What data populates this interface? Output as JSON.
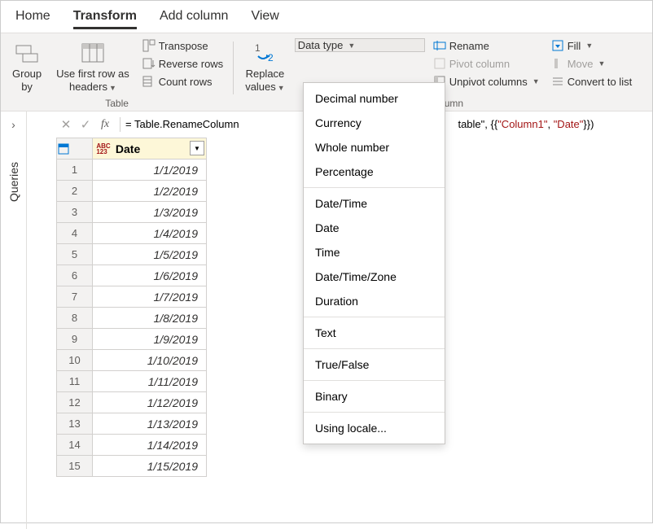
{
  "tabs": {
    "home": "Home",
    "transform": "Transform",
    "addcolumn": "Add column",
    "view": "View",
    "active": "Transform"
  },
  "ribbon": {
    "groupBy": "Group\nby",
    "useFirstRow": "Use first row as\nheaders",
    "transpose": "Transpose",
    "reverseRows": "Reverse rows",
    "countRows": "Count rows",
    "tableGroup": "Table",
    "replaceValues": "Replace\nvalues",
    "dataType": "Data type",
    "rename": "Rename",
    "fill": "Fill",
    "pivotColumn": "Pivot column",
    "move": "Move",
    "unpivotColumns": "Unpivot columns",
    "convertToList": "Convert to list",
    "anyColumnGroup": "Any column"
  },
  "formula": {
    "prefix": "= ",
    "fn": "Table.RenameColumn",
    "mid": "table\", {{",
    "s1": "\"Column1\"",
    "sep": ", ",
    "s2": "\"Date\"",
    "end": "}})"
  },
  "sidebar": {
    "label": "Queries"
  },
  "column": {
    "name": "Date"
  },
  "rows": [
    {
      "n": "1",
      "v": "1/1/2019"
    },
    {
      "n": "2",
      "v": "1/2/2019"
    },
    {
      "n": "3",
      "v": "1/3/2019"
    },
    {
      "n": "4",
      "v": "1/4/2019"
    },
    {
      "n": "5",
      "v": "1/5/2019"
    },
    {
      "n": "6",
      "v": "1/6/2019"
    },
    {
      "n": "7",
      "v": "1/7/2019"
    },
    {
      "n": "8",
      "v": "1/8/2019"
    },
    {
      "n": "9",
      "v": "1/9/2019"
    },
    {
      "n": "10",
      "v": "1/10/2019"
    },
    {
      "n": "11",
      "v": "1/11/2019"
    },
    {
      "n": "12",
      "v": "1/12/2019"
    },
    {
      "n": "13",
      "v": "1/13/2019"
    },
    {
      "n": "14",
      "v": "1/14/2019"
    },
    {
      "n": "15",
      "v": "1/15/2019"
    }
  ],
  "dataTypeMenu": {
    "decimal": "Decimal number",
    "currency": "Currency",
    "whole": "Whole number",
    "percentage": "Percentage",
    "datetime": "Date/Time",
    "date": "Date",
    "time": "Time",
    "dtz": "Date/Time/Zone",
    "duration": "Duration",
    "text": "Text",
    "truefalse": "True/False",
    "binary": "Binary",
    "locale": "Using locale..."
  }
}
